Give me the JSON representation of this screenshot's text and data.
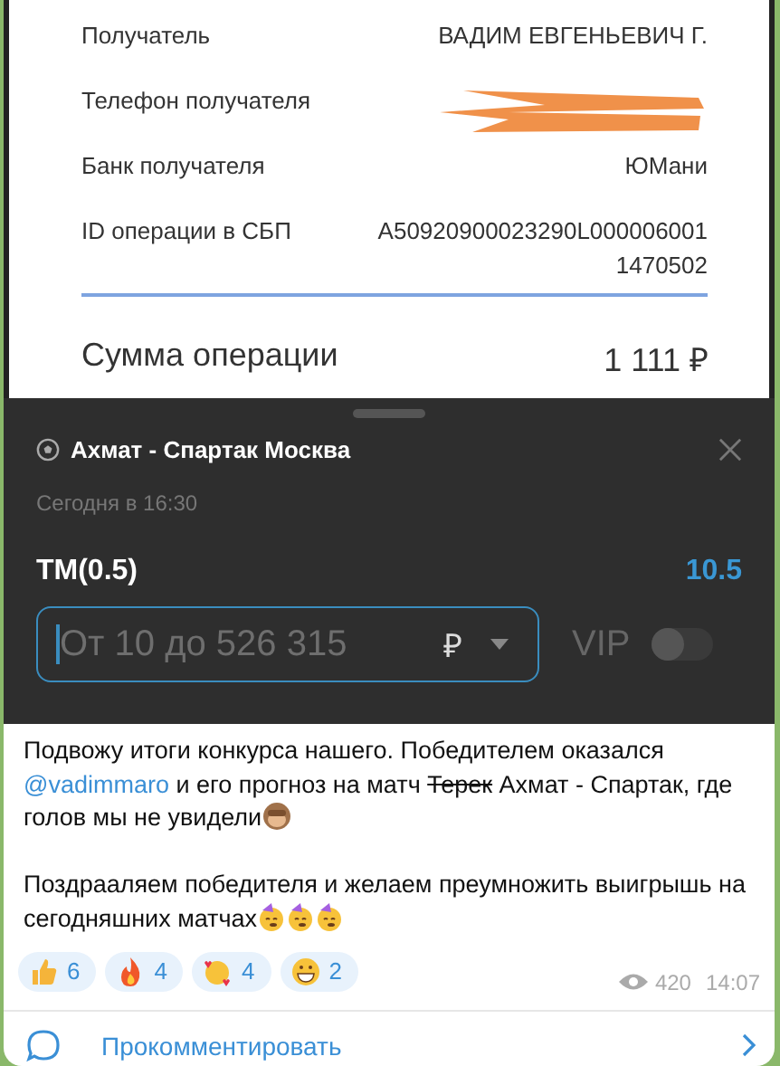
{
  "receipt": {
    "rows": [
      {
        "label": "Получатель",
        "value": "ВАДИМ ЕВГЕНЬЕВИЧ Г."
      },
      {
        "label": "Телефон получателя",
        "redacted": true
      },
      {
        "label": "Банк получателя",
        "value": "ЮМани"
      },
      {
        "label": "ID операции в СБП",
        "value": "A50920900023290L000006001 1470502"
      }
    ],
    "total": {
      "label": "Сумма операции",
      "value": "1 111 ₽"
    }
  },
  "bet_slip": {
    "match": "Ахмат - Спартак Москва",
    "time": "Сегодня в 16:30",
    "outcome": "ТМ(0.5)",
    "odds": "10.5",
    "stake": {
      "placeholder": "От 10 до 526 315",
      "currency": "₽",
      "focused": true
    },
    "vip": {
      "label": "VIP",
      "on": false
    }
  },
  "message": {
    "paragraphs": [
      [
        {
          "text": "Подвожу итоги конкурса нашего. Победителем оказался "
        },
        {
          "kind": "mention",
          "text": "@vadimmaro"
        },
        {
          "text": " и его прогноз на матч "
        },
        {
          "kind": "strike",
          "text": "Терек"
        },
        {
          "text": " Ахмат - Спартак, где голов мы не увидели"
        },
        {
          "kind": "monkey-emoji"
        }
      ],
      [
        {
          "text": "Поздрааляем победителя и желаем преумножить выигрышь на сегодняшних матчах"
        },
        {
          "kind": "party-emoji"
        },
        {
          "kind": "party-emoji"
        },
        {
          "kind": "party-emoji"
        }
      ]
    ],
    "reactions": [
      {
        "kind": "thumbs-up",
        "count": "6"
      },
      {
        "kind": "fire",
        "count": "4"
      },
      {
        "kind": "hearts-face",
        "count": "4"
      },
      {
        "kind": "grin",
        "count": "2"
      }
    ],
    "views": "420",
    "time": "14:07"
  },
  "comments": {
    "label": "Прокомментировать"
  }
}
